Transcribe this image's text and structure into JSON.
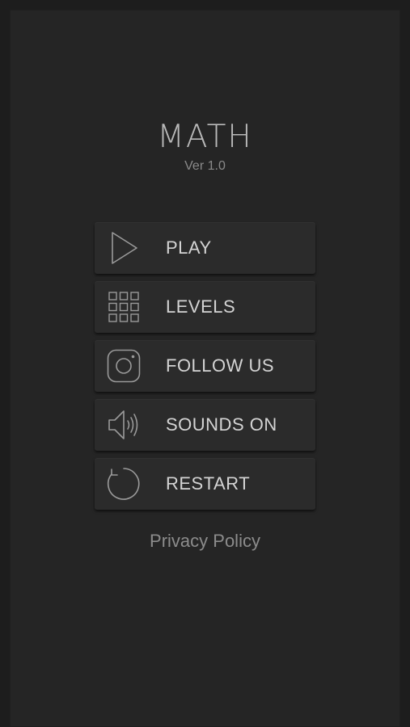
{
  "app": {
    "title": "MATH",
    "version": "Ver 1.0"
  },
  "menu": {
    "items": [
      {
        "label": "PLAY",
        "icon": "play-icon"
      },
      {
        "label": "LEVELS",
        "icon": "grid-icon"
      },
      {
        "label": "FOLLOW US",
        "icon": "instagram-icon"
      },
      {
        "label": "SOUNDS ON",
        "icon": "speaker-icon"
      },
      {
        "label": "RESTART",
        "icon": "restart-icon"
      }
    ]
  },
  "footer": {
    "privacy_label": "Privacy Policy"
  },
  "colors": {
    "background": "#252525",
    "button": "#2b2b2b",
    "text": "#d4d4d4",
    "icon": "#9a9a9a"
  }
}
